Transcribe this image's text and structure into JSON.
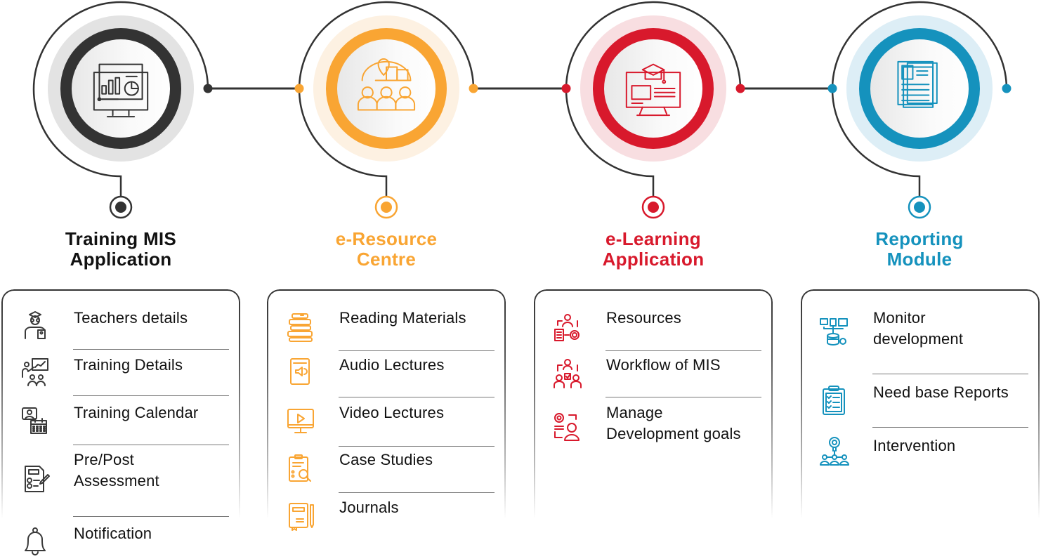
{
  "columns": [
    {
      "id": "training-mis",
      "title_lines": [
        "Training MIS",
        "Application"
      ],
      "color": "#333333",
      "halo": "#e3e3e3",
      "title_color": "#111111",
      "main_icon": "monitor-dashboard-icon",
      "items": [
        {
          "label_lines": [
            "Teachers details"
          ],
          "icon": "teacher-icon"
        },
        {
          "label_lines": [
            "Training Details"
          ],
          "icon": "presentation-icon"
        },
        {
          "label_lines": [
            "Training Calendar"
          ],
          "icon": "calendar-video-icon"
        },
        {
          "label_lines": [
            "Pre/Post",
            "Assessment"
          ],
          "icon": "assessment-checklist-icon"
        },
        {
          "label_lines": [
            "Notification"
          ],
          "icon": "bell-icon"
        }
      ]
    },
    {
      "id": "e-resource",
      "title_lines": [
        "e-Resource",
        "Centre"
      ],
      "color": "#f9a533",
      "halo": "#fdf1e2",
      "title_color": "#f9a533",
      "main_icon": "resource-centre-icon",
      "items": [
        {
          "label_lines": [
            "Reading Materials"
          ],
          "icon": "books-icon"
        },
        {
          "label_lines": [
            "Audio Lectures"
          ],
          "icon": "audio-book-icon"
        },
        {
          "label_lines": [
            "Video Lectures"
          ],
          "icon": "video-monitor-icon"
        },
        {
          "label_lines": [
            "Case Studies"
          ],
          "icon": "clipboard-search-icon"
        },
        {
          "label_lines": [
            "Journals"
          ],
          "icon": "journal-pen-icon"
        }
      ]
    },
    {
      "id": "e-learning",
      "title_lines": [
        "e-Learning",
        "Application"
      ],
      "color": "#d8192c",
      "halo": "#f8dee1",
      "title_color": "#d8192c",
      "main_icon": "graduation-monitor-icon",
      "items": [
        {
          "label_lines": [
            "Resources"
          ],
          "icon": "resource-cycle-icon"
        },
        {
          "label_lines": [
            "Workflow of MIS"
          ],
          "icon": "workflow-icon"
        },
        {
          "label_lines": [
            "Manage",
            "Development goals"
          ],
          "icon": "goals-gear-icon"
        }
      ]
    },
    {
      "id": "reporting",
      "title_lines": [
        "Reporting",
        "Module"
      ],
      "color": "#1592bd",
      "halo": "#ddeef6",
      "title_color": "#1592bd",
      "main_icon": "report-documents-icon",
      "items": [
        {
          "label_lines": [
            "Monitor",
            "development"
          ],
          "icon": "database-network-icon"
        },
        {
          "label_lines": [
            "Need base Reports"
          ],
          "icon": "clipboard-checklist-icon"
        },
        {
          "label_lines": [
            "Intervention"
          ],
          "icon": "idea-team-icon"
        }
      ]
    }
  ],
  "connector_color": "#333333"
}
